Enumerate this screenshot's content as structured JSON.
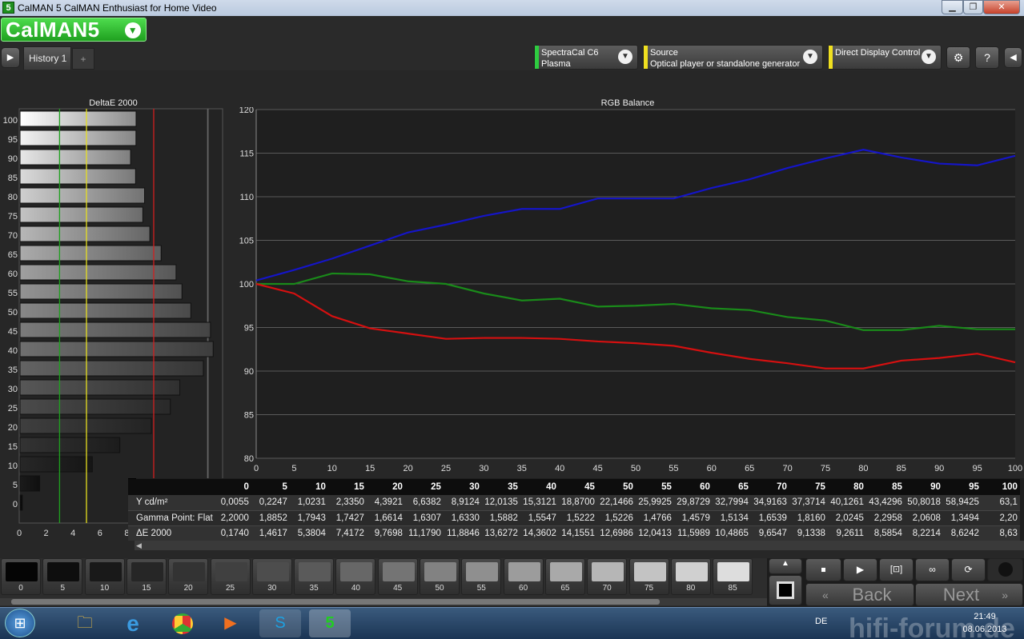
{
  "window": {
    "title": "CalMAN 5 CalMAN Enthusiast for Home Video",
    "app_icon": "5"
  },
  "logo": {
    "text": "CalMAN5"
  },
  "tabs": [
    {
      "label": "History 1"
    }
  ],
  "tab_add": "+",
  "devices": [
    {
      "line1": "SpectraCal C6",
      "line2": "Plasma",
      "color": "#2ecc40"
    },
    {
      "line1": "Source",
      "line2": "Optical player or standalone generator",
      "color": "#f0e020"
    },
    {
      "line1": "Direct Display Control",
      "line2": "",
      "color": "#f0e020"
    }
  ],
  "deltae_chart": {
    "title": "DeltaE 2000",
    "y_labels": [
      "100",
      "95",
      "90",
      "85",
      "80",
      "75",
      "70",
      "65",
      "60",
      "55",
      "50",
      "45",
      "40",
      "35",
      "30",
      "25",
      "20",
      "15",
      "10",
      "5",
      "0"
    ],
    "x_labels": [
      "0",
      "2",
      "4",
      "6",
      "8"
    ]
  },
  "chart_data": [
    {
      "type": "bar",
      "title": "DeltaE 2000",
      "orientation": "horizontal",
      "categories": [
        "100",
        "95",
        "90",
        "85",
        "80",
        "75",
        "70",
        "65",
        "60",
        "55",
        "50",
        "45",
        "40",
        "35",
        "30",
        "25",
        "20",
        "15",
        "10",
        "5",
        "0"
      ],
      "values": [
        8.63,
        8.62,
        8.22,
        8.59,
        9.26,
        9.13,
        9.65,
        10.49,
        11.6,
        12.04,
        12.7,
        14.16,
        14.36,
        13.63,
        11.88,
        11.18,
        9.77,
        7.42,
        5.38,
        1.46,
        0.17
      ],
      "xlim": [
        0,
        8
      ],
      "reference_lines": [
        {
          "x": 3,
          "color": "#1fa01f"
        },
        {
          "x": 5,
          "color": "#e8e020"
        },
        {
          "x": 10,
          "color": "#d02020"
        }
      ]
    },
    {
      "type": "line",
      "title": "RGB Balance",
      "x": [
        0,
        5,
        10,
        15,
        20,
        25,
        30,
        35,
        40,
        45,
        50,
        55,
        60,
        65,
        70,
        75,
        80,
        85,
        90,
        95,
        100
      ],
      "ylim": [
        80,
        120
      ],
      "xlim": [
        0,
        100
      ],
      "y_ticks": [
        80,
        85,
        90,
        95,
        100,
        105,
        110,
        115,
        120
      ],
      "series": [
        {
          "color": "#1515c8",
          "values": [
            100.4,
            101.6,
            102.9,
            104.4,
            105.9,
            106.8,
            107.8,
            108.6,
            108.6,
            109.8,
            109.8,
            109.8,
            111.0,
            112.0,
            113.3,
            114.4,
            115.4,
            114.5,
            113.8,
            113.6,
            114.7
          ]
        },
        {
          "color": "#1a8a1a",
          "values": [
            100.0,
            100.0,
            101.2,
            101.1,
            100.3,
            100.0,
            98.9,
            98.1,
            98.3,
            97.4,
            97.5,
            97.7,
            97.2,
            97.0,
            96.2,
            95.8,
            94.7,
            94.7,
            95.2,
            94.8,
            94.8
          ]
        },
        {
          "color": "#d41010",
          "values": [
            100.0,
            98.9,
            96.3,
            94.9,
            94.3,
            93.7,
            93.8,
            93.8,
            93.7,
            93.4,
            93.2,
            92.9,
            92.1,
            91.4,
            90.9,
            90.3,
            90.3,
            91.2,
            91.5,
            92.0,
            91.0
          ]
        }
      ]
    }
  ],
  "rgb_chart": {
    "title": "RGB Balance",
    "y_labels": [
      "120",
      "115",
      "110",
      "105",
      "100",
      "95",
      "90",
      "85",
      "80"
    ],
    "x_labels": [
      "0",
      "5",
      "10",
      "15",
      "20",
      "25",
      "30",
      "35",
      "40",
      "45",
      "50",
      "55",
      "60",
      "65",
      "70",
      "75",
      "80",
      "85",
      "90",
      "95",
      "100"
    ]
  },
  "table": {
    "columns": [
      "0",
      "5",
      "10",
      "15",
      "20",
      "25",
      "30",
      "35",
      "40",
      "45",
      "50",
      "55",
      "60",
      "65",
      "70",
      "75",
      "80",
      "85",
      "90",
      "95",
      "100"
    ],
    "rows": [
      {
        "label": "Y cd/m²",
        "values": [
          "0,0055",
          "0,2247",
          "1,0231",
          "2,3350",
          "4,3921",
          "6,6382",
          "8,9124",
          "12,0135",
          "15,3121",
          "18,8700",
          "22,1466",
          "25,9925",
          "29,8729",
          "32,7994",
          "34,9163",
          "37,3714",
          "40,1261",
          "43,4296",
          "50,8018",
          "58,9425",
          "63,1"
        ]
      },
      {
        "label": "Gamma Point: Flat",
        "values": [
          "2,2000",
          "1,8852",
          "1,7943",
          "1,7427",
          "1,6614",
          "1,6307",
          "1,6330",
          "1,5882",
          "1,5547",
          "1,5222",
          "1,5226",
          "1,4766",
          "1,4579",
          "1,5134",
          "1,6539",
          "1,8160",
          "2,0245",
          "2,2958",
          "2,0608",
          "1,3494",
          "2,20"
        ]
      },
      {
        "label": "ΔE 2000",
        "values": [
          "0,1740",
          "1,4617",
          "5,3804",
          "7,4172",
          "9,7698",
          "11,1790",
          "11,8846",
          "13,6272",
          "14,3602",
          "14,1551",
          "12,6986",
          "12,0413",
          "11,5989",
          "10,4865",
          "9,6547",
          "9,1338",
          "9,2611",
          "8,5854",
          "8,2214",
          "8,6242",
          "8,63"
        ]
      }
    ]
  },
  "swatches": [
    {
      "label": "0",
      "color": "#050505"
    },
    {
      "label": "5",
      "color": "#0e0e0e"
    },
    {
      "label": "10",
      "color": "#191919"
    },
    {
      "label": "15",
      "color": "#262626"
    },
    {
      "label": "20",
      "color": "#333333"
    },
    {
      "label": "25",
      "color": "#404040"
    },
    {
      "label": "30",
      "color": "#4d4d4d"
    },
    {
      "label": "35",
      "color": "#5a5a5a"
    },
    {
      "label": "40",
      "color": "#676767"
    },
    {
      "label": "45",
      "color": "#747474"
    },
    {
      "label": "50",
      "color": "#828282"
    },
    {
      "label": "55",
      "color": "#8f8f8f"
    },
    {
      "label": "60",
      "color": "#9c9c9c"
    },
    {
      "label": "65",
      "color": "#a9a9a9"
    },
    {
      "label": "70",
      "color": "#b6b6b6"
    },
    {
      "label": "75",
      "color": "#c3c3c3"
    },
    {
      "label": "80",
      "color": "#d0d0d0"
    },
    {
      "label": "85",
      "color": "#dddddd"
    }
  ],
  "controls": {
    "back": "Back",
    "next": "Next"
  },
  "taskbar": {
    "lang": "DE",
    "time": "21:49",
    "date": "08.06.2013",
    "watermark": "hifi-forum.de"
  }
}
